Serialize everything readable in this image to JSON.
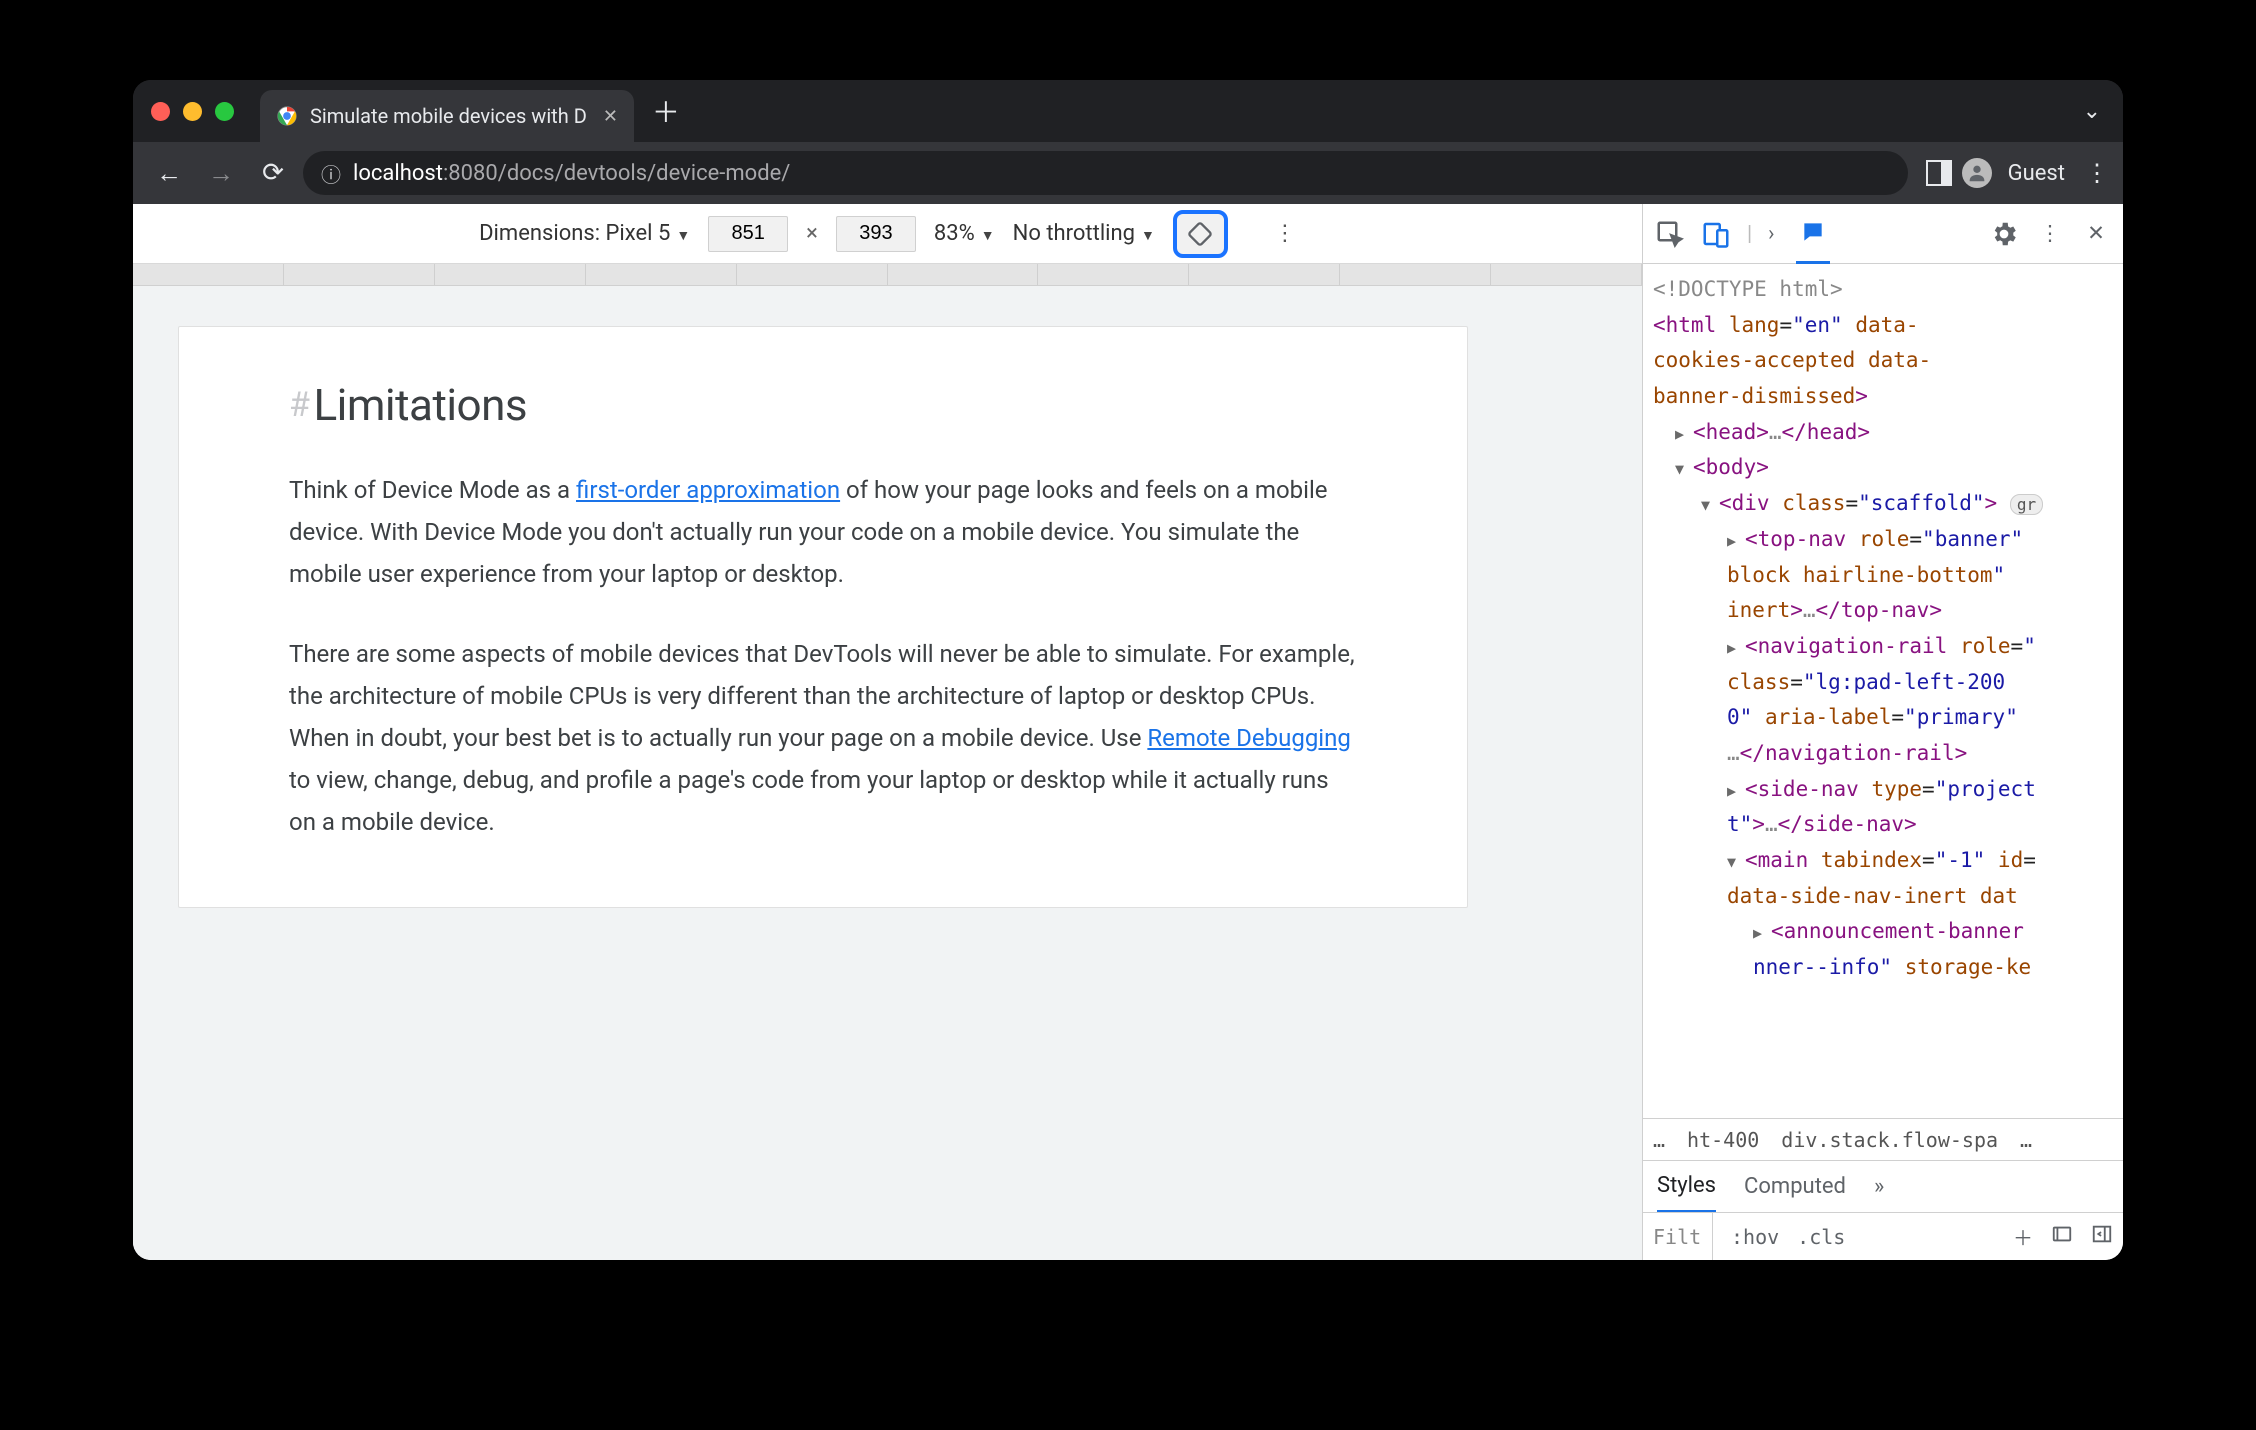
{
  "tab": {
    "title": "Simulate mobile devices with D"
  },
  "omnibox": {
    "host": "localhost",
    "port": ":8080",
    "path": "/docs/devtools/device-mode/"
  },
  "guest_label": "Guest",
  "device_toolbar": {
    "dimensions_label": "Dimensions: Pixel 5",
    "width": "851",
    "times": "×",
    "height": "393",
    "zoom": "83%",
    "throttling": "No throttling"
  },
  "page": {
    "heading": "Limitations",
    "p1_a": "Think of Device Mode as a ",
    "p1_link": "first-order approximation",
    "p1_b": " of how your page looks and feels on a mobile device. With Device Mode you don't actually run your code on a mobile device. You simulate the mobile user experience from your laptop or desktop.",
    "p2_a": "There are some aspects of mobile devices that DevTools will never be able to simulate. For example, the architecture of mobile CPUs is very different than the architecture of laptop or desktop CPUs. When in doubt, your best bet is to actually run your page on a mobile device. Use ",
    "p2_link": "Remote Debugging",
    "p2_b": " to view, change, debug, and profile a page's code from your laptop or desktop while it actually runs on a mobile device."
  },
  "dom": {
    "doctype": "<!DOCTYPE html>",
    "html_open_1": "<html lang=\"en\" data-",
    "html_open_2": "cookies-accepted data-",
    "html_open_3": "banner-dismissed>",
    "head": "<head>…</head>",
    "body": "<body>",
    "div_scaffold": "<div class=\"scaffold\">",
    "scaffold_pill": "gr",
    "topnav_1": "<top-nav role=\"banner\" ",
    "topnav_2": "block hairline-bottom\" ",
    "topnav_3": "inert>…</top-nav>",
    "navrail_1": "<navigation-rail role=\"",
    "navrail_2": "class=\"lg:pad-left-200 ",
    "navrail_3": "0\" aria-label=\"primary\" ",
    "navrail_4": "…</navigation-rail>",
    "sidenav_1": "<side-nav type=\"project",
    "sidenav_2": "t\">…</side-nav>",
    "main_1": "<main tabindex=\"-1\" id=",
    "main_2": "data-side-nav-inert dat",
    "ann_1": "<announcement-banner ",
    "ann_2": "nner--info\" storage-ke"
  },
  "breadcrumbs": {
    "a": "…",
    "b": "ht-400",
    "c": "div.stack.flow-spa",
    "d": "…"
  },
  "styles": {
    "tab_styles": "Styles",
    "tab_computed": "Computed",
    "more": "»",
    "filter": "Filt",
    "hov": ":hov",
    "cls": ".cls"
  }
}
